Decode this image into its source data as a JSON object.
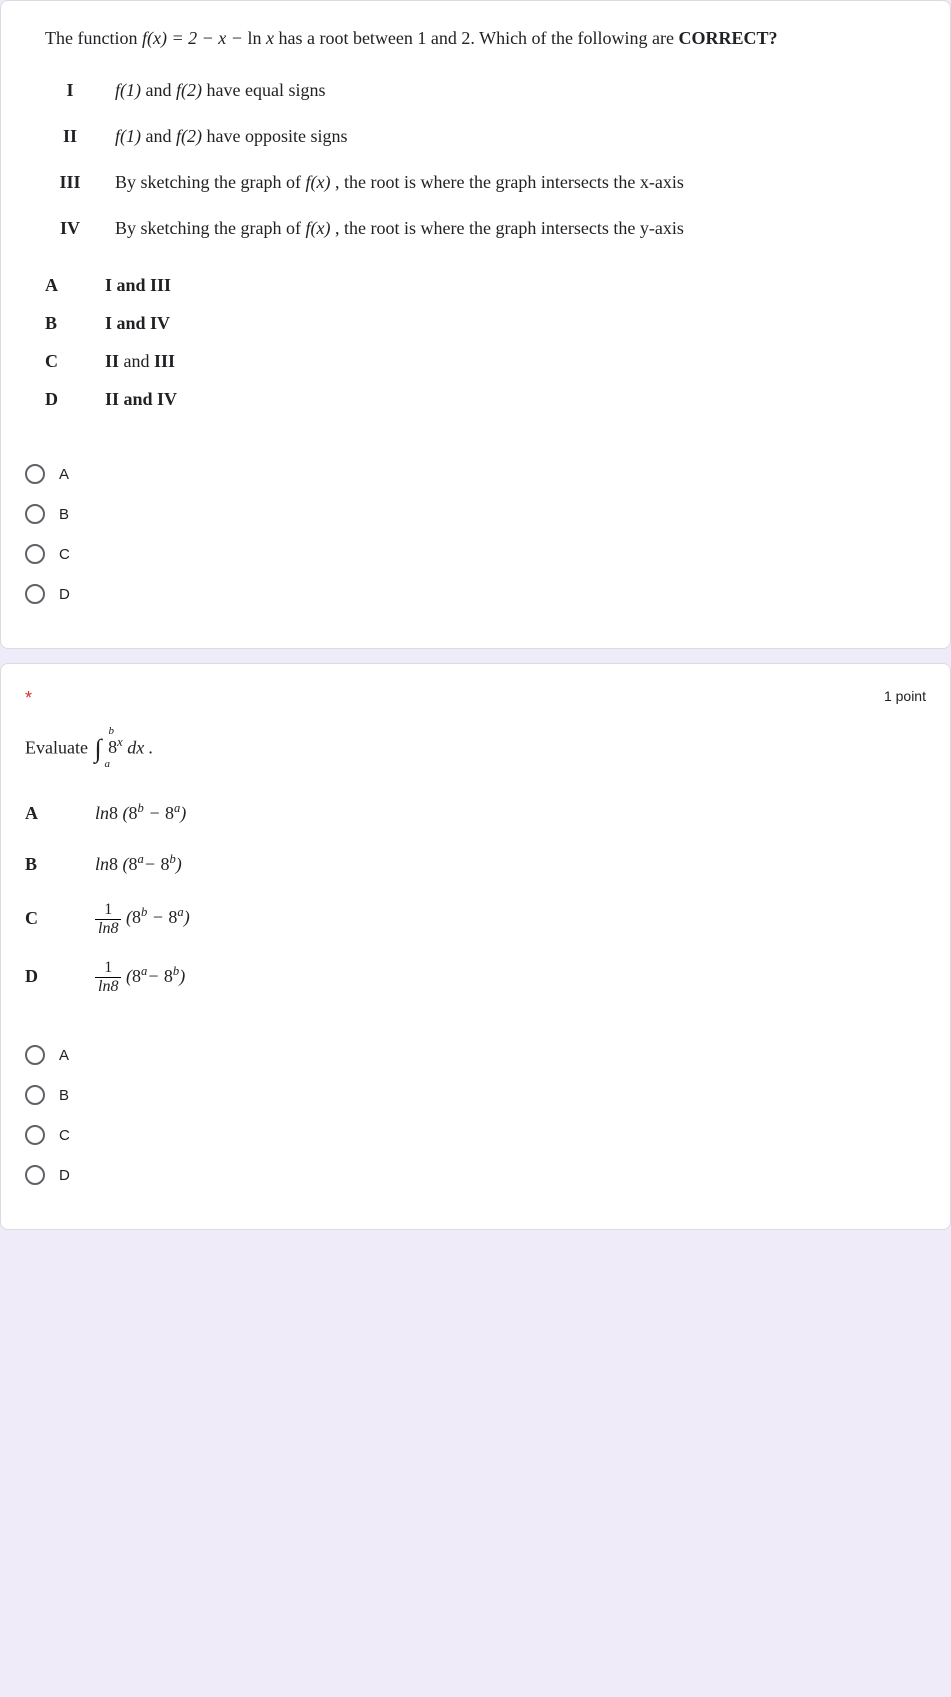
{
  "q1": {
    "text_pre": "The function ",
    "text_func": "f(x) = 2 − x − ln x",
    "text_post": " has a root between 1 and 2. Which of the following are ",
    "text_correct": "CORRECT?",
    "statements": [
      {
        "num": "I",
        "pre": "",
        "f1": "f(1)",
        "mid": " and ",
        "f2": "f(2)",
        "post": " have equal signs"
      },
      {
        "num": "II",
        "pre": "",
        "f1": "f(1)",
        "mid": " and ",
        "f2": "f(2)",
        "post": " have opposite signs"
      },
      {
        "num": "III",
        "pre": "By sketching the graph of ",
        "fx": "f(x)",
        "post": ", the root is where the graph intersects the x-axis"
      },
      {
        "num": "IV",
        "pre": "By sketching the graph of ",
        "fx": "f(x)",
        "post": ", the root is where the graph intersects the y-axis"
      }
    ],
    "answers": [
      {
        "letter": "A",
        "text": "I and III"
      },
      {
        "letter": "B",
        "text": "I and IV"
      },
      {
        "letter": "C",
        "text": "II and  III"
      },
      {
        "letter": "D",
        "text": "II and IV"
      }
    ],
    "options": [
      "A",
      "B",
      "C",
      "D"
    ]
  },
  "q2": {
    "required_mark": "*",
    "points": "1 point",
    "evaluate_label": "Evaluate ",
    "integrand": "8",
    "integrand_exp": "x",
    "dx": " dx .",
    "int_lower": "a",
    "int_upper": "b",
    "answers": [
      {
        "letter": "A",
        "ln": "ln",
        "base": "8",
        "p1b": "8",
        "p1e": "b",
        "minus": " − ",
        "p2b": "8",
        "p2e": "a"
      },
      {
        "letter": "B",
        "ln": "ln",
        "base": "8",
        "p1b": "8",
        "p1e": "a",
        "minus": "− ",
        "p2b": "8",
        "p2e": "b"
      },
      {
        "letter": "C",
        "frac_num": "1",
        "frac_den": "ln8",
        "p1b": "8",
        "p1e": "b",
        "minus": " − ",
        "p2b": "8",
        "p2e": "a"
      },
      {
        "letter": "D",
        "frac_num": "1",
        "frac_den": "ln8",
        "p1b": "8",
        "p1e": "a",
        "minus": "− ",
        "p2b": "8",
        "p2e": "b"
      }
    ],
    "options": [
      "A",
      "B",
      "C",
      "D"
    ]
  }
}
